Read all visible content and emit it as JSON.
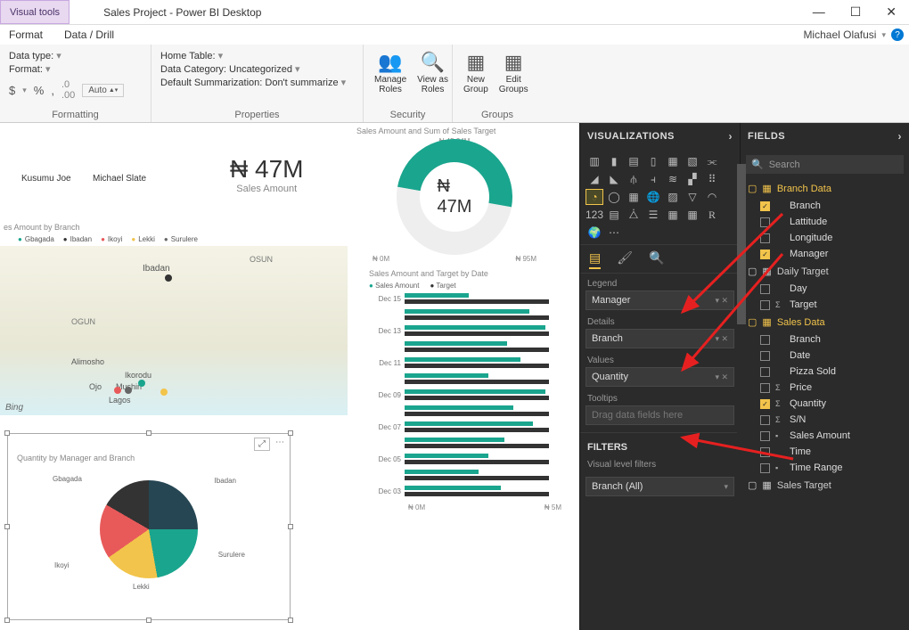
{
  "titlebar": {
    "visual_tools": "Visual tools",
    "app_title": "Sales Project - Power BI Desktop"
  },
  "menubar": {
    "format": "Format",
    "data_drill": "Data / Drill",
    "user": "Michael Olafusi"
  },
  "ribbon": {
    "formatting": {
      "data_type": "Data type:",
      "format": "Format:",
      "currency": "$",
      "percent": "%",
      "comma": ",",
      "auto": "Auto",
      "group": "Formatting"
    },
    "properties": {
      "home_table": "Home Table:",
      "data_category": "Data Category: Uncategorized",
      "default_sum": "Default Summarization: Don't summarize",
      "group": "Properties"
    },
    "security": {
      "manage": "Manage\nRoles",
      "viewas": "View as\nRoles",
      "group": "Security"
    },
    "groups": {
      "new": "New\nGroup",
      "edit": "Edit\nGroups",
      "group": "Groups"
    }
  },
  "canvas": {
    "slicer1": "Kusumu Joe",
    "slicer2": "Michael Slate",
    "kpi_value": "₦ 47M",
    "kpi_label": "Sales Amount",
    "donut_title": "Sales Amount and Sum of Sales Target",
    "donut_top": "₦ 45.24M",
    "donut_center": "₦ 47M",
    "donut_left": "₦ 0M",
    "donut_right": "₦ 95M",
    "map_title": "es Amount by Branch",
    "map_legend": [
      "Gbagada",
      "Ibadan",
      "Ikoyi",
      "Lekki",
      "Surulere"
    ],
    "map_bing": "Bing",
    "bar_title": "Sales Amount and Target by Date",
    "bar_legend": [
      "Sales Amount",
      "Target"
    ],
    "pie_title": "Quantity by Manager and Branch",
    "pie_labels": [
      "Gbagada",
      "Ibadan",
      "Ikoyi",
      "Lekki",
      "Surulere"
    ],
    "axis_min": "₦ 0M",
    "axis_max": "₦ 5M"
  },
  "viz_pane": {
    "title": "VISUALIZATIONS",
    "legend_lbl": "Legend",
    "legend_val": "Manager",
    "details_lbl": "Details",
    "details_val": "Branch",
    "values_lbl": "Values",
    "values_val": "Quantity",
    "tooltips_lbl": "Tooltips",
    "tooltips_ph": "Drag data fields here",
    "filters": "FILTERS",
    "vlf": "Visual level filters",
    "branch_all": "Branch (All)"
  },
  "fields_pane": {
    "title": "FIELDS",
    "search": "Search",
    "tables": {
      "branch_data": "Branch Data",
      "daily_target": "Daily Target",
      "sales_data": "Sales Data",
      "sales_target": "Sales Target"
    },
    "branch_fields": {
      "branch": "Branch",
      "lat": "Lattitude",
      "lon": "Longitude",
      "manager": "Manager"
    },
    "daily_fields": {
      "day": "Day",
      "target": "Target"
    },
    "sales_fields": {
      "branch": "Branch",
      "date": "Date",
      "pizza": "Pizza Sold",
      "price": "Price",
      "quantity": "Quantity",
      "sn": "S/N",
      "sales_amount": "Sales Amount",
      "time": "Time",
      "time_range": "Time Range"
    }
  },
  "chart_data": [
    {
      "type": "kpi",
      "value": 47000000,
      "currency": "₦",
      "label": "Sales Amount"
    },
    {
      "type": "gauge",
      "title": "Sales Amount and Sum of Sales Target",
      "value": 47000000,
      "target": 45240000,
      "min": 0,
      "max": 95000000,
      "currency": "₦"
    },
    {
      "type": "bar",
      "title": "Sales Amount and Target by Date",
      "orientation": "horizontal",
      "categories": [
        "Dec 15",
        "",
        "Dec 13",
        "",
        "Dec 11",
        "",
        "Dec 09",
        "",
        "Dec 07",
        "",
        "Dec 05",
        "",
        "Dec 03"
      ],
      "series": [
        {
          "name": "Sales Amount",
          "values": [
            2.0,
            3.9,
            4.4,
            3.2,
            3.6,
            2.6,
            4.4,
            3.4,
            4.0,
            3.1,
            2.6,
            2.3,
            3.0
          ]
        },
        {
          "name": "Target",
          "values": [
            4.5,
            4.5,
            4.5,
            4.5,
            4.5,
            4.5,
            4.5,
            4.5,
            4.5,
            4.5,
            4.5,
            4.5,
            4.5
          ]
        }
      ],
      "xlabel": "",
      "ylabel": "",
      "xlim": [
        0,
        5
      ],
      "unit": "₦ M"
    },
    {
      "type": "pie",
      "title": "Quantity by Manager and Branch",
      "categories": [
        "Gbagada",
        "Ibadan",
        "Ikoyi",
        "Lekki",
        "Surulere"
      ],
      "values": [
        25,
        22,
        18,
        17,
        18
      ]
    }
  ]
}
